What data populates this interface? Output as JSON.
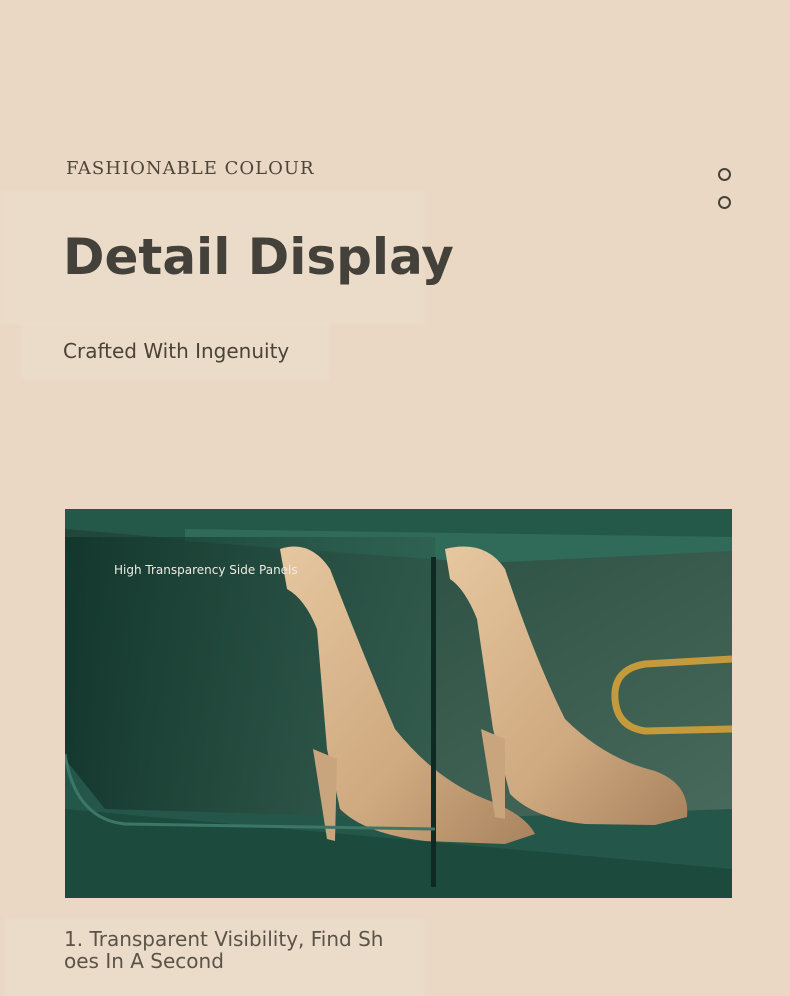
{
  "header": {
    "eyebrow": "FASHIONABLE COLOUR",
    "title": "Detail Display",
    "subtitle": "Crafted With Ingenuity"
  },
  "pagination": {
    "count": 2
  },
  "photo": {
    "label": "High Transparency Side Panels"
  },
  "caption": "1. Transparent Visibility, Find Shoes In A Second",
  "colors": {
    "background": "#ead8c5",
    "text_dark": "#44413a",
    "box_green": "#2a5a4a",
    "shoe": "#d7b48c"
  }
}
